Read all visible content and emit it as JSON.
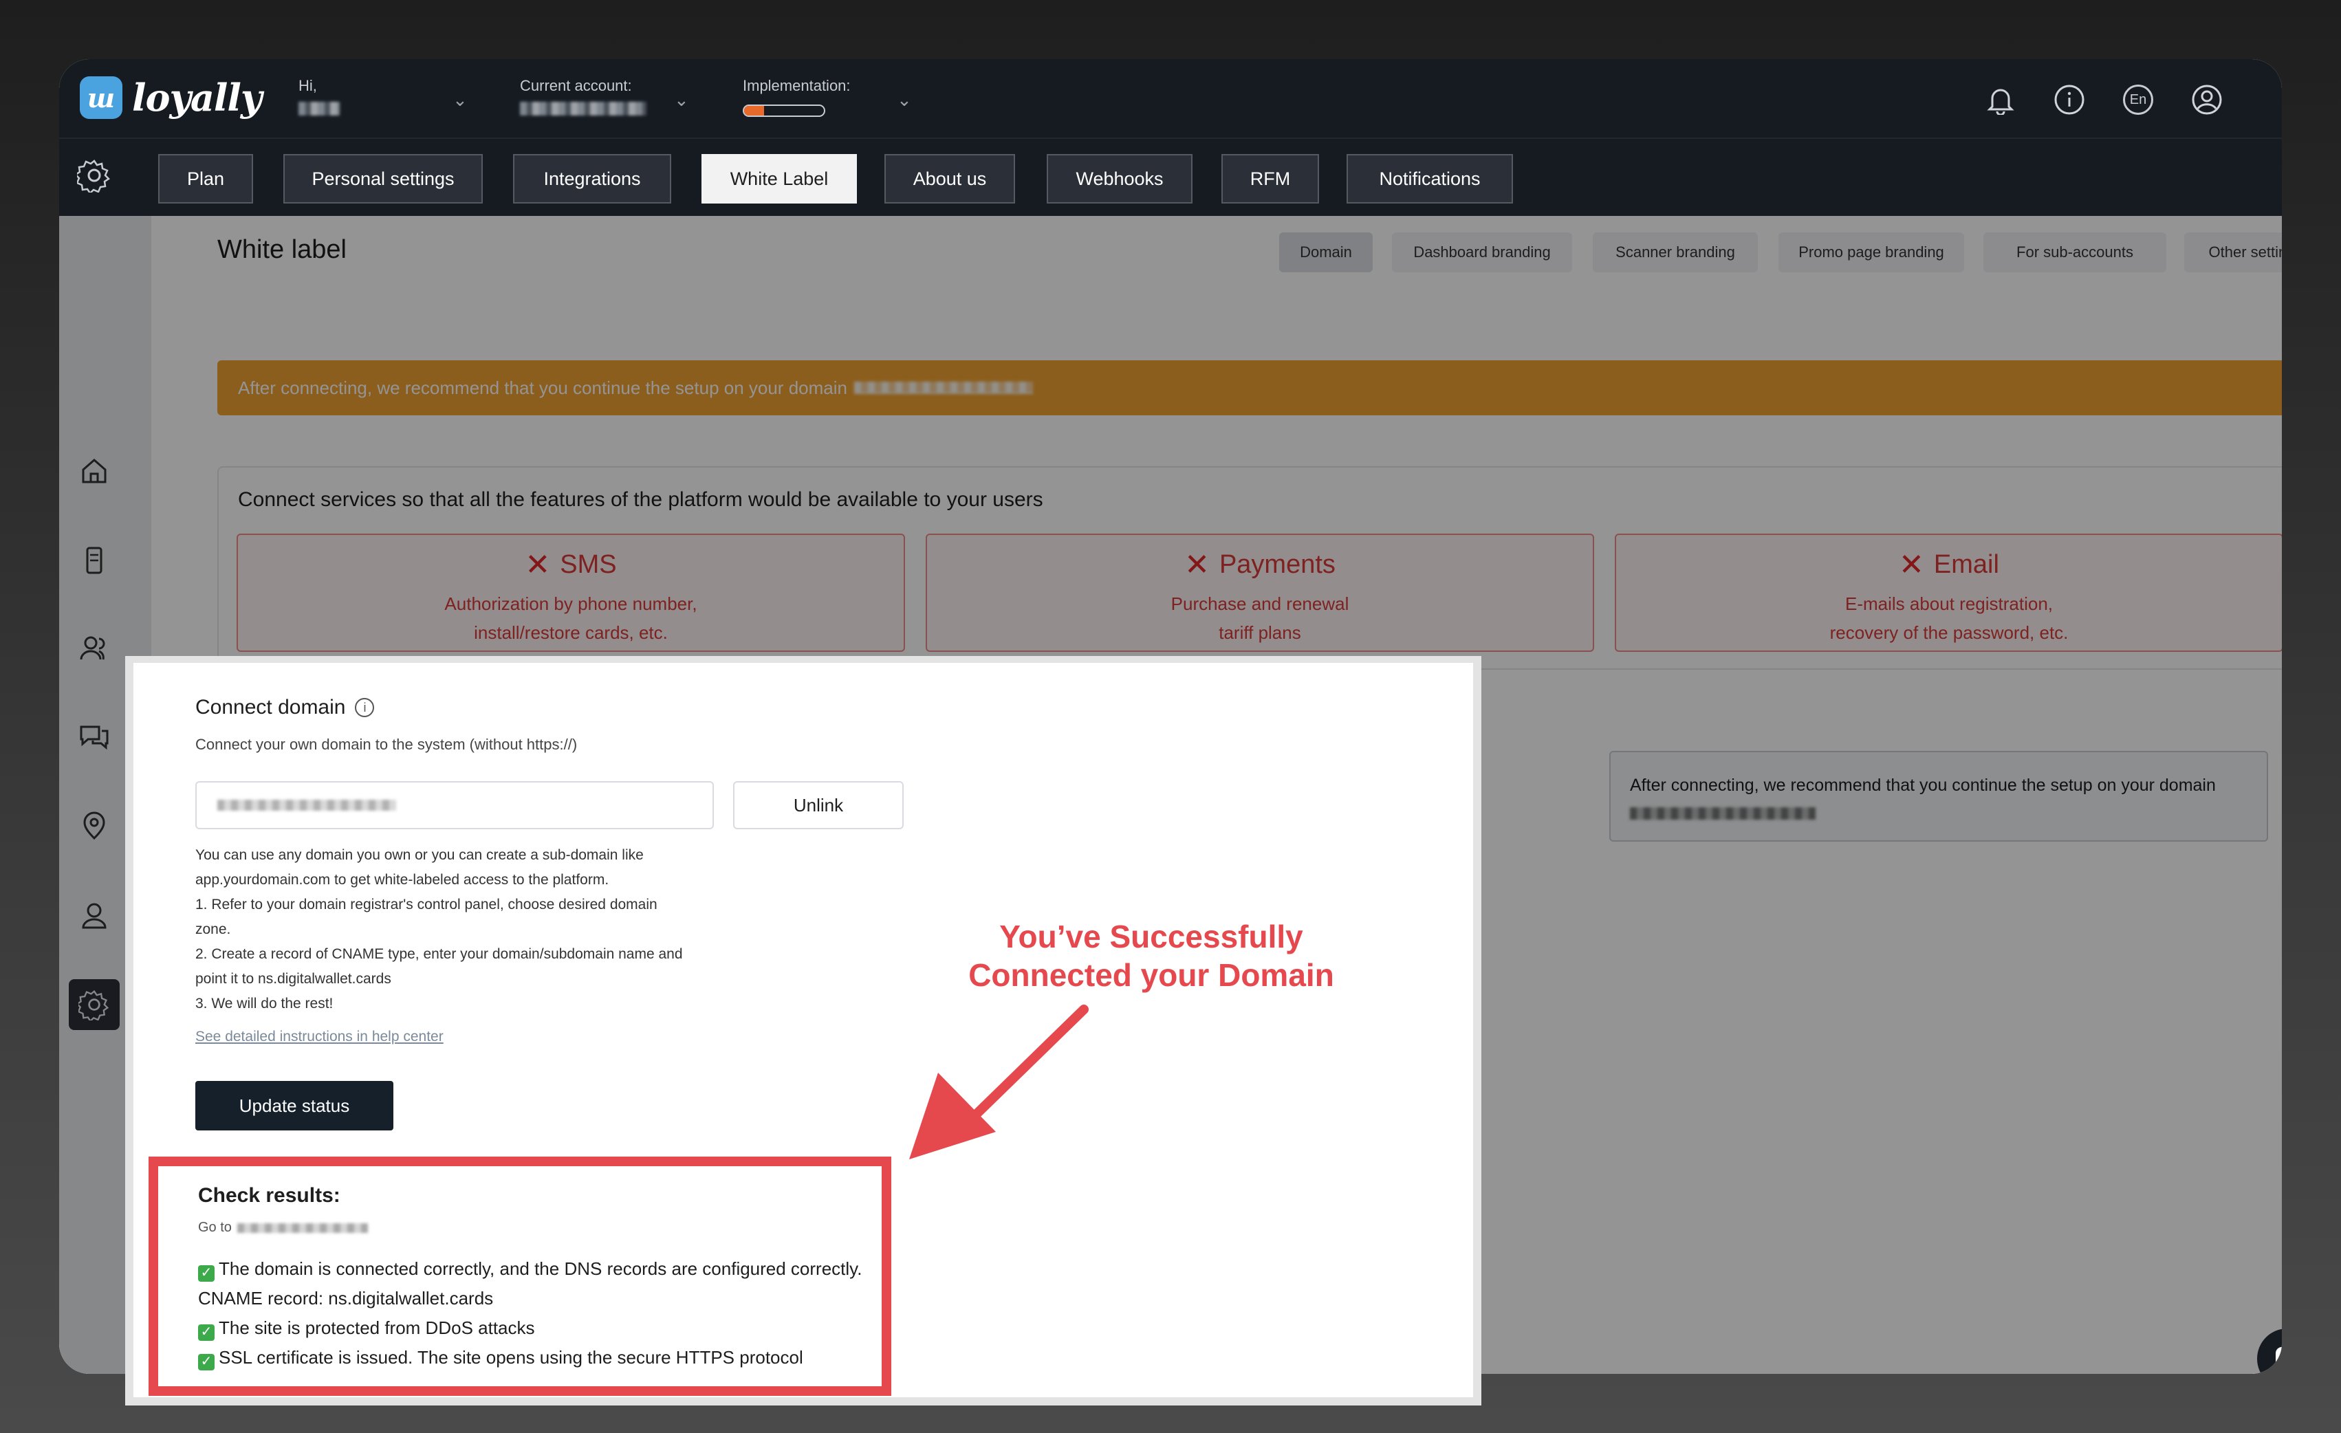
{
  "header": {
    "logo_glyph": "ш",
    "logo_text": "loyally",
    "greeting_label": "Hi,",
    "account_label": "Current account:",
    "implementation_label": "Implementation:",
    "implementation_progress": 0.25,
    "lang": "En",
    "icons": [
      "bell-icon",
      "info-icon",
      "language-icon",
      "profile-icon"
    ]
  },
  "settings_tabs": [
    {
      "label": "Plan",
      "active": false
    },
    {
      "label": "Personal settings",
      "active": false
    },
    {
      "label": "Integrations",
      "active": false
    },
    {
      "label": "White Label",
      "active": true
    },
    {
      "label": "About us",
      "active": false
    },
    {
      "label": "Webhooks",
      "active": false
    },
    {
      "label": "RFM",
      "active": false
    },
    {
      "label": "Notifications",
      "active": false
    }
  ],
  "page": {
    "title": "White label",
    "subtabs": [
      {
        "label": "Domain",
        "active": true
      },
      {
        "label": "Dashboard branding",
        "active": false
      },
      {
        "label": "Scanner branding",
        "active": false
      },
      {
        "label": "Promo page branding",
        "active": false
      },
      {
        "label": "For sub-accounts",
        "active": false
      },
      {
        "label": "Other settings",
        "active": false
      }
    ],
    "banner_text": "After connecting, we recommend that you continue the setup on your domain"
  },
  "services": {
    "title": "Connect services so that all the features of the platform would be available to your users",
    "cards": [
      {
        "name": "SMS",
        "line1": "Authorization by phone number,",
        "line2": "install/restore cards, etc."
      },
      {
        "name": "Payments",
        "line1": "Purchase and renewal",
        "line2": "tariff plans"
      },
      {
        "name": "Email",
        "line1": "E-mails about registration,",
        "line2": "recovery of the password, etc."
      }
    ]
  },
  "info_right": {
    "text": "After connecting, we recommend that you continue the setup on your domain"
  },
  "connect_domain": {
    "title": "Connect domain",
    "subtitle": "Connect your own domain to the system (without https://)",
    "unlink_label": "Unlink",
    "instructions": [
      "You can use any domain you own or you can create a sub-domain like",
      "app.yourdomain.com to get white-labeled access to the platform.",
      "1. Refer to your domain registrar's control panel, choose desired domain",
      "zone.",
      "2. Create a record of CNAME type, enter your domain/subdomain name and",
      "point it to ns.digitalwallet.cards",
      "3. We will do the rest!"
    ],
    "help_link": "See detailed instructions in help center",
    "update_label": "Update status"
  },
  "check_results": {
    "title": "Check results:",
    "goto_label": "Go to",
    "line1": "The domain is connected correctly, and the DNS records are configured correctly.",
    "line2": "CNAME record: ns.digitalwallet.cards",
    "line3": "The site is protected from DDoS attacks",
    "line4": "SSL certificate is issued. The site opens using the secure HTTPS protocol"
  },
  "callout": {
    "line1": "You’ve Successfully",
    "line2": "Connected your Domain"
  },
  "colors": {
    "header_bg": "#161b22",
    "banner": "#f0a232",
    "error_red": "#e0262a",
    "highlight_red": "#e5484d",
    "check_green": "#3ca94a"
  }
}
